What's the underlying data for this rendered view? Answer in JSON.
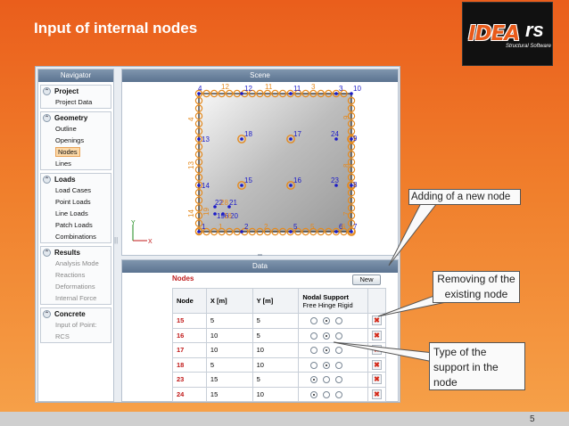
{
  "slide": {
    "title": "Input of internal nodes",
    "page_number": "5"
  },
  "logo": {
    "word": "IDEA",
    "suffix": "rs",
    "tagline": "Structural Software"
  },
  "navigator": {
    "title": "Navigator",
    "groups": [
      {
        "label": "Project",
        "items": [
          {
            "label": "Project Data",
            "enabled": true
          }
        ]
      },
      {
        "label": "Geometry",
        "items": [
          {
            "label": "Outline",
            "enabled": true
          },
          {
            "label": "Openings",
            "enabled": true
          },
          {
            "label": "Nodes",
            "enabled": true,
            "active": true
          },
          {
            "label": "Lines",
            "enabled": true
          }
        ]
      },
      {
        "label": "Loads",
        "items": [
          {
            "label": "Load Cases",
            "enabled": true
          },
          {
            "label": "Point Loads",
            "enabled": true
          },
          {
            "label": "Line Loads",
            "enabled": true
          },
          {
            "label": "Patch Loads",
            "enabled": true
          },
          {
            "label": "Combinations",
            "enabled": true
          }
        ]
      },
      {
        "label": "Results",
        "items": [
          {
            "label": "Analysis Mode",
            "enabled": false
          },
          {
            "label": "Reactions",
            "enabled": false
          },
          {
            "label": "Deformations",
            "enabled": false
          },
          {
            "label": "Internal Force",
            "enabled": false
          }
        ]
      },
      {
        "label": "Concrete",
        "items": [
          {
            "label": "Input of Point:",
            "enabled": false
          },
          {
            "label": "RCS",
            "enabled": false
          }
        ]
      }
    ]
  },
  "scene": {
    "title": "Scene",
    "axis_y": "Y",
    "axis_x": "X",
    "node_labels_blue": [
      "4",
      "12",
      "11",
      "3",
      "10",
      "13",
      "18",
      "17",
      "24",
      "9",
      "14",
      "15",
      "16",
      "23",
      "8",
      "22",
      "21",
      "19",
      "20",
      "1",
      "2",
      "5",
      "6",
      "7"
    ],
    "line_labels_orange": [
      "12",
      "11",
      "3",
      "4",
      "13",
      "14",
      "2",
      "5",
      "6",
      "8",
      "7",
      "9",
      "28",
      "19",
      "16",
      "20"
    ]
  },
  "data": {
    "title": "Data",
    "section_title": "Nodes",
    "new_button": "New",
    "columns": {
      "node": "Node",
      "x": "X [m]",
      "y": "Y [m]",
      "support": "Nodal Support",
      "support_sub": "Free Hinge Rigid"
    },
    "rows": [
      {
        "node": "15",
        "x": "5",
        "y": "5",
        "support": "hinge"
      },
      {
        "node": "16",
        "x": "10",
        "y": "5",
        "support": "hinge"
      },
      {
        "node": "17",
        "x": "10",
        "y": "10",
        "support": "hinge"
      },
      {
        "node": "18",
        "x": "5",
        "y": "10",
        "support": "hinge"
      },
      {
        "node": "23",
        "x": "15",
        "y": "5",
        "support": "free"
      },
      {
        "node": "24",
        "x": "15",
        "y": "10",
        "support": "free"
      }
    ]
  },
  "callouts": {
    "adding": "Adding of a new node",
    "removing": "Removing of the existing node",
    "type": "Type of the support in the node"
  },
  "colors": {
    "background": "#ef7a28",
    "node_blue": "#1a1ac8",
    "label_orange": "#e58a1e",
    "node_id_red": "#c01818"
  }
}
